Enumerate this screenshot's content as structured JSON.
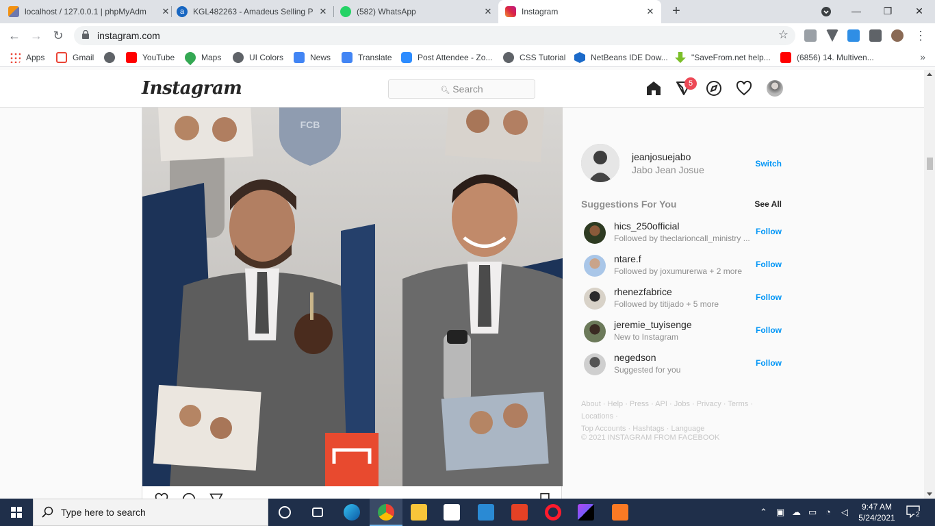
{
  "browser": {
    "tabs": [
      {
        "title": "localhost / 127.0.0.1 | phpMyAdm",
        "icon": "phpmyadmin-icon"
      },
      {
        "title": "KGL482263 - Amadeus Selling Pla",
        "icon": "amadeus-icon"
      },
      {
        "title": "(582) WhatsApp",
        "icon": "whatsapp-icon"
      },
      {
        "title": "Instagram",
        "icon": "instagram-icon",
        "active": true
      }
    ],
    "url": "instagram.com",
    "bookmarks": [
      "Apps",
      "Gmail",
      "",
      "YouTube",
      "Maps",
      "UI Colors",
      "News",
      "Translate",
      "Post Attendee - Zo...",
      "CSS Tutorial",
      "NetBeans IDE Dow...",
      "\"SaveFrom.net help...",
      "(6856) 14. Multiven..."
    ],
    "bookmarks_more": "»"
  },
  "instagram": {
    "logo": "Instagram",
    "search_placeholder": "Search",
    "activity_badge": "5",
    "me": {
      "username": "jeanjosuejabo",
      "name": "Jabo Jean Josue",
      "switch": "Switch"
    },
    "suggestions_title": "Suggestions For You",
    "see_all": "See All",
    "suggestions": [
      {
        "username": "hics_250official",
        "sub": "Followed by theclarioncall_ministry ...",
        "action": "Follow"
      },
      {
        "username": "ntare.f",
        "sub": "Followed by joxumurerwa + 2 more",
        "action": "Follow"
      },
      {
        "username": "rhenezfabrice",
        "sub": "Followed by titijado + 5 more",
        "action": "Follow"
      },
      {
        "username": "jeremie_tuyisenge",
        "sub": "New to Instagram",
        "action": "Follow"
      },
      {
        "username": "negedson",
        "sub": "Suggested for you",
        "action": "Follow"
      }
    ],
    "footer_line1": "About · Help · Press · API · Jobs · Privacy · Terms · Locations ·",
    "footer_line2": "Top Accounts · Hashtags · Language",
    "copyright": "© 2021 INSTAGRAM FROM FACEBOOK",
    "post_photo_badge": "FCB"
  },
  "taskbar": {
    "search_text": "Type here to search",
    "time": "9:47 AM",
    "date": "5/24/2021",
    "notifications": "2"
  },
  "colors": {
    "follow_blue": "#0095f6",
    "badge_red": "#ed4956",
    "taskbar": "#1f2f4a"
  }
}
